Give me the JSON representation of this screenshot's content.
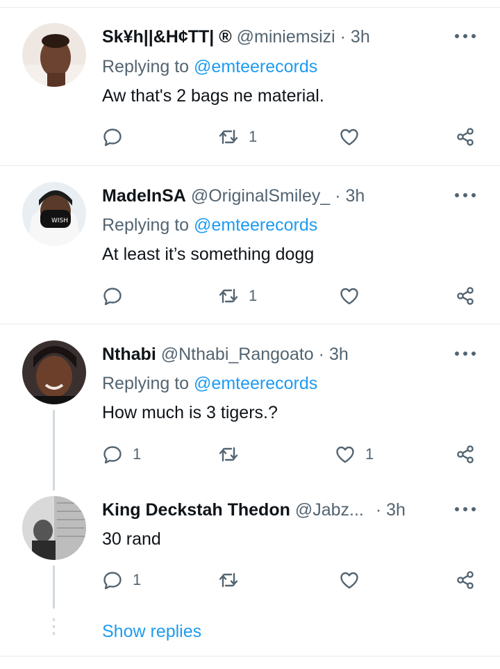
{
  "tweets": [
    {
      "name": "Sk¥h||&H¢TT| ®",
      "handle": "@miniemsizi",
      "separator": "·",
      "time": "3h",
      "reply_prefix": "Replying to",
      "reply_to": "@emteerecords",
      "text": "Aw that's 2 bags ne material.",
      "reply_count": "",
      "retweet_count": "1",
      "like_count": ""
    },
    {
      "name": "MadeInSA",
      "handle": "@OriginalSmiley_",
      "separator": "·",
      "time": "3h",
      "reply_prefix": "Replying to",
      "reply_to": "@emteerecords",
      "text": "At least it’s something dogg",
      "reply_count": "",
      "retweet_count": "1",
      "like_count": ""
    },
    {
      "name": "Nthabi",
      "handle": "@Nthabi_Rangoato",
      "separator": "·",
      "time": "3h",
      "reply_prefix": "Replying to",
      "reply_to": "@emteerecords",
      "text": "How much is 3 tigers.?",
      "reply_count": "1",
      "retweet_count": "",
      "like_count": "1"
    },
    {
      "name": "King Deckstah Thedon",
      "handle": "@Jabz...",
      "separator": "·",
      "time": "3h",
      "text": "30 rand",
      "reply_count": "1",
      "retweet_count": "",
      "like_count": ""
    }
  ],
  "show_replies": "Show replies",
  "colors": {
    "accent": "#1d9bf0",
    "muted": "#536471",
    "text": "#0f1419",
    "divider": "#e6ecf0",
    "thread_line": "#cfd9de"
  },
  "icons": {
    "more": "more-dots-icon",
    "reply": "reply-bubble-icon",
    "retweet": "retweet-icon",
    "like": "heart-icon",
    "share": "share-icon"
  }
}
